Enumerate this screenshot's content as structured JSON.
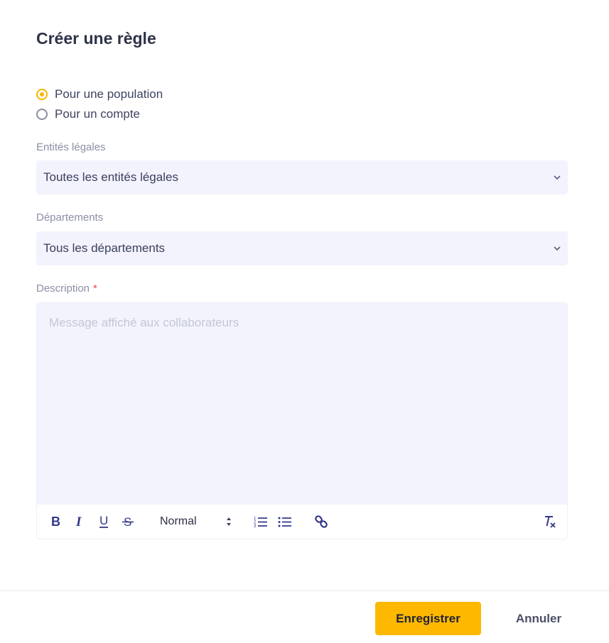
{
  "dialog": {
    "title": "Créer une règle"
  },
  "target": {
    "options": [
      {
        "label": "Pour une population",
        "checked": true
      },
      {
        "label": "Pour un compte",
        "checked": false
      }
    ]
  },
  "legal_entities": {
    "label": "Entités légales",
    "value": "Toutes les entités légales"
  },
  "departments": {
    "label": "Départements",
    "value": "Tous les départements"
  },
  "description": {
    "label": "Description",
    "required_mark": "*",
    "placeholder": "Message affiché aux collaborateurs",
    "toolbar": {
      "bold": "B",
      "italic": "I",
      "underline": "U",
      "strike": "S",
      "heading": "Normal",
      "ordered_list": "ordered-list-icon",
      "bullet_list": "bullet-list-icon",
      "link": "link-icon",
      "clear": "clear-format-icon"
    }
  },
  "actions": {
    "save": "Enregistrer",
    "cancel": "Annuler"
  },
  "colors": {
    "accent": "#ffb800",
    "field_bg": "#f2f3fd",
    "toolbar_icon": "#33388a"
  }
}
